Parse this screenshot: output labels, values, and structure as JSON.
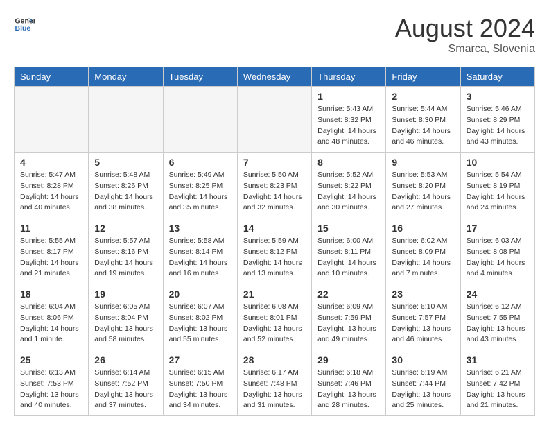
{
  "logo": {
    "line1": "General",
    "line2": "Blue"
  },
  "title": "August 2024",
  "location": "Smarca, Slovenia",
  "headers": [
    "Sunday",
    "Monday",
    "Tuesday",
    "Wednesday",
    "Thursday",
    "Friday",
    "Saturday"
  ],
  "weeks": [
    [
      {
        "day": "",
        "info": ""
      },
      {
        "day": "",
        "info": ""
      },
      {
        "day": "",
        "info": ""
      },
      {
        "day": "",
        "info": ""
      },
      {
        "day": "1",
        "info": "Sunrise: 5:43 AM\nSunset: 8:32 PM\nDaylight: 14 hours\nand 48 minutes."
      },
      {
        "day": "2",
        "info": "Sunrise: 5:44 AM\nSunset: 8:30 PM\nDaylight: 14 hours\nand 46 minutes."
      },
      {
        "day": "3",
        "info": "Sunrise: 5:46 AM\nSunset: 8:29 PM\nDaylight: 14 hours\nand 43 minutes."
      }
    ],
    [
      {
        "day": "4",
        "info": "Sunrise: 5:47 AM\nSunset: 8:28 PM\nDaylight: 14 hours\nand 40 minutes."
      },
      {
        "day": "5",
        "info": "Sunrise: 5:48 AM\nSunset: 8:26 PM\nDaylight: 14 hours\nand 38 minutes."
      },
      {
        "day": "6",
        "info": "Sunrise: 5:49 AM\nSunset: 8:25 PM\nDaylight: 14 hours\nand 35 minutes."
      },
      {
        "day": "7",
        "info": "Sunrise: 5:50 AM\nSunset: 8:23 PM\nDaylight: 14 hours\nand 32 minutes."
      },
      {
        "day": "8",
        "info": "Sunrise: 5:52 AM\nSunset: 8:22 PM\nDaylight: 14 hours\nand 30 minutes."
      },
      {
        "day": "9",
        "info": "Sunrise: 5:53 AM\nSunset: 8:20 PM\nDaylight: 14 hours\nand 27 minutes."
      },
      {
        "day": "10",
        "info": "Sunrise: 5:54 AM\nSunset: 8:19 PM\nDaylight: 14 hours\nand 24 minutes."
      }
    ],
    [
      {
        "day": "11",
        "info": "Sunrise: 5:55 AM\nSunset: 8:17 PM\nDaylight: 14 hours\nand 21 minutes."
      },
      {
        "day": "12",
        "info": "Sunrise: 5:57 AM\nSunset: 8:16 PM\nDaylight: 14 hours\nand 19 minutes."
      },
      {
        "day": "13",
        "info": "Sunrise: 5:58 AM\nSunset: 8:14 PM\nDaylight: 14 hours\nand 16 minutes."
      },
      {
        "day": "14",
        "info": "Sunrise: 5:59 AM\nSunset: 8:12 PM\nDaylight: 14 hours\nand 13 minutes."
      },
      {
        "day": "15",
        "info": "Sunrise: 6:00 AM\nSunset: 8:11 PM\nDaylight: 14 hours\nand 10 minutes."
      },
      {
        "day": "16",
        "info": "Sunrise: 6:02 AM\nSunset: 8:09 PM\nDaylight: 14 hours\nand 7 minutes."
      },
      {
        "day": "17",
        "info": "Sunrise: 6:03 AM\nSunset: 8:08 PM\nDaylight: 14 hours\nand 4 minutes."
      }
    ],
    [
      {
        "day": "18",
        "info": "Sunrise: 6:04 AM\nSunset: 8:06 PM\nDaylight: 14 hours\nand 1 minute."
      },
      {
        "day": "19",
        "info": "Sunrise: 6:05 AM\nSunset: 8:04 PM\nDaylight: 13 hours\nand 58 minutes."
      },
      {
        "day": "20",
        "info": "Sunrise: 6:07 AM\nSunset: 8:02 PM\nDaylight: 13 hours\nand 55 minutes."
      },
      {
        "day": "21",
        "info": "Sunrise: 6:08 AM\nSunset: 8:01 PM\nDaylight: 13 hours\nand 52 minutes."
      },
      {
        "day": "22",
        "info": "Sunrise: 6:09 AM\nSunset: 7:59 PM\nDaylight: 13 hours\nand 49 minutes."
      },
      {
        "day": "23",
        "info": "Sunrise: 6:10 AM\nSunset: 7:57 PM\nDaylight: 13 hours\nand 46 minutes."
      },
      {
        "day": "24",
        "info": "Sunrise: 6:12 AM\nSunset: 7:55 PM\nDaylight: 13 hours\nand 43 minutes."
      }
    ],
    [
      {
        "day": "25",
        "info": "Sunrise: 6:13 AM\nSunset: 7:53 PM\nDaylight: 13 hours\nand 40 minutes."
      },
      {
        "day": "26",
        "info": "Sunrise: 6:14 AM\nSunset: 7:52 PM\nDaylight: 13 hours\nand 37 minutes."
      },
      {
        "day": "27",
        "info": "Sunrise: 6:15 AM\nSunset: 7:50 PM\nDaylight: 13 hours\nand 34 minutes."
      },
      {
        "day": "28",
        "info": "Sunrise: 6:17 AM\nSunset: 7:48 PM\nDaylight: 13 hours\nand 31 minutes."
      },
      {
        "day": "29",
        "info": "Sunrise: 6:18 AM\nSunset: 7:46 PM\nDaylight: 13 hours\nand 28 minutes."
      },
      {
        "day": "30",
        "info": "Sunrise: 6:19 AM\nSunset: 7:44 PM\nDaylight: 13 hours\nand 25 minutes."
      },
      {
        "day": "31",
        "info": "Sunrise: 6:21 AM\nSunset: 7:42 PM\nDaylight: 13 hours\nand 21 minutes."
      }
    ]
  ]
}
